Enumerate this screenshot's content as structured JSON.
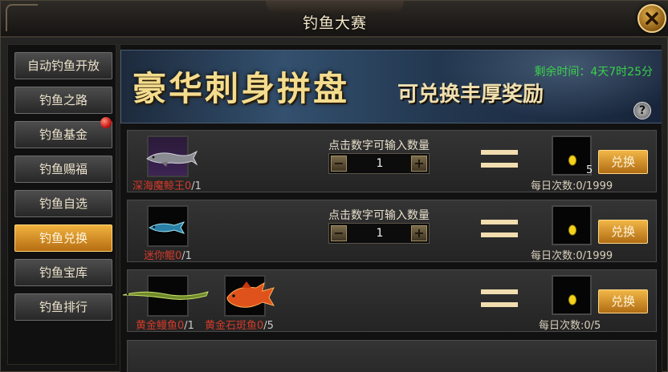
{
  "window": {
    "title": "钓鱼大赛"
  },
  "sidebar": {
    "items": [
      {
        "label": "自动钓鱼开放",
        "active": false,
        "badge": false
      },
      {
        "label": "钓鱼之路",
        "active": false,
        "badge": false
      },
      {
        "label": "钓鱼基金",
        "active": false,
        "badge": true
      },
      {
        "label": "钓鱼赐福",
        "active": false,
        "badge": false
      },
      {
        "label": "钓鱼自选",
        "active": false,
        "badge": false
      },
      {
        "label": "钓鱼兑换",
        "active": true,
        "badge": false
      },
      {
        "label": "钓鱼宝库",
        "active": false,
        "badge": false
      },
      {
        "label": "钓鱼排行",
        "active": false,
        "badge": false
      }
    ]
  },
  "banner": {
    "title": "豪华刺身拼盘",
    "subtitle": "可兑换丰厚奖励",
    "countdown": "剩余时间：4天7时25分",
    "help": "?"
  },
  "exchange": {
    "qty_hint": "点击数字可输入数量",
    "button_label": "兑换",
    "rows": [
      {
        "items": [
          {
            "name": "深海魔鲸王",
            "have": "0",
            "need": "/1",
            "icon": "whale-icon"
          }
        ],
        "qty": "1",
        "reward_count": "5",
        "daily": "每日次数:0/1999"
      },
      {
        "items": [
          {
            "name": "迷你鲲",
            "have": "0",
            "need": "/1",
            "icon": "mini-kun-fish-icon"
          }
        ],
        "qty": "1",
        "reward_count": "",
        "daily": "每日次数:0/1999"
      },
      {
        "items": [
          {
            "name": "黄金鳗鱼",
            "have": "0",
            "need": "/1",
            "icon": "golden-eel-icon"
          },
          {
            "name": "黄金石斑鱼",
            "have": "0",
            "need": "/5",
            "icon": "golden-grouper-icon"
          }
        ],
        "qty": "",
        "reward_count": "",
        "daily": "每日次数:0/5"
      }
    ]
  },
  "colors": {
    "accent_gold": "#f0b23f",
    "countdown_green": "#39d04a",
    "item_name_red": "#d23a2a",
    "badge_red": "#c21010"
  }
}
